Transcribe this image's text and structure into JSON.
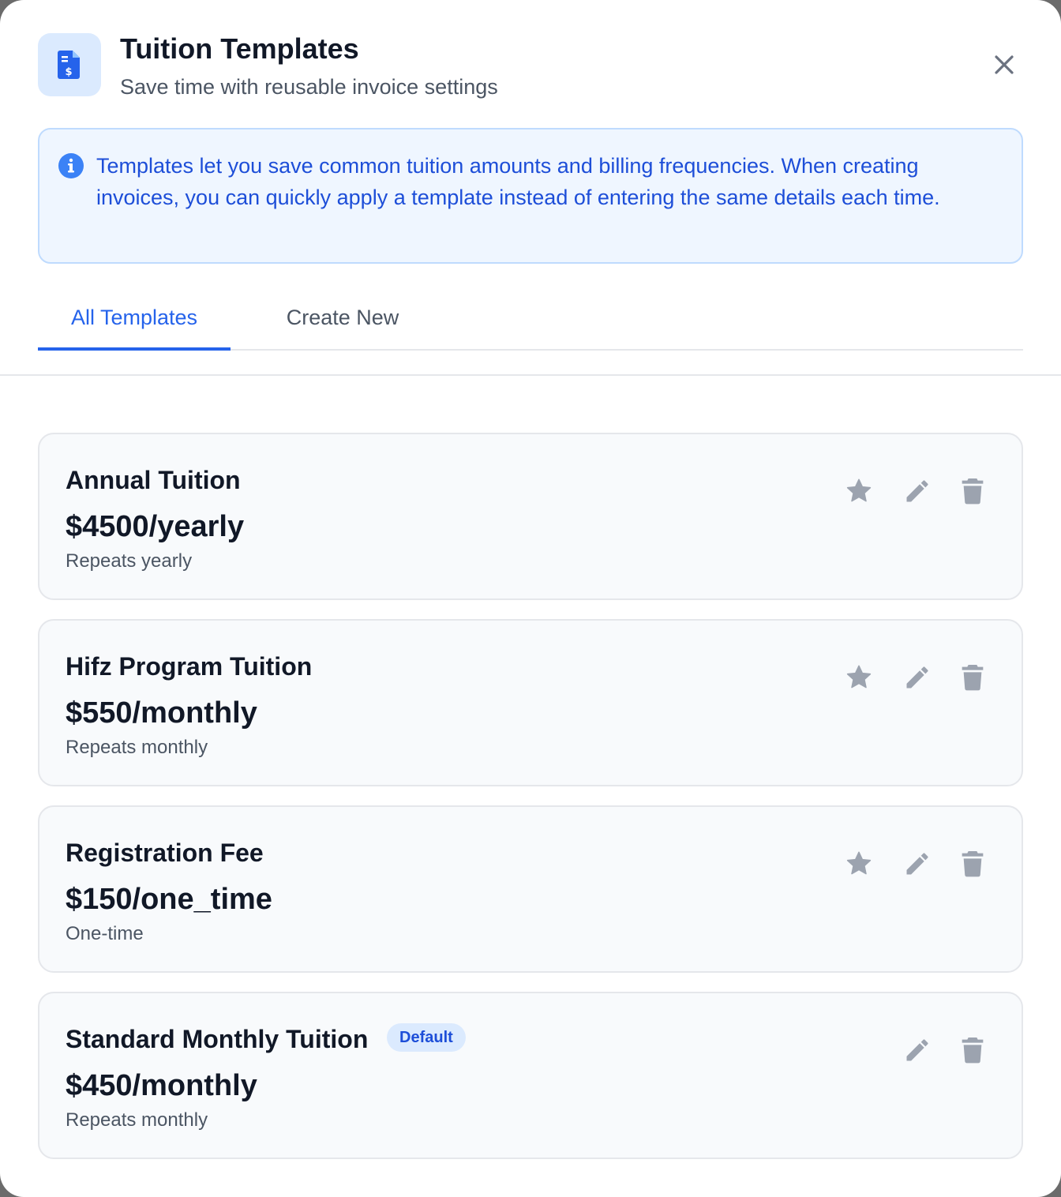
{
  "header": {
    "title": "Tuition Templates",
    "subtitle": "Save time with reusable invoice settings",
    "icon": "invoice-dollar-icon"
  },
  "info": {
    "text": "Templates let you save common tuition amounts and billing frequencies. When creating invoices, you can quickly apply a template instead of entering the same details each time."
  },
  "tabs": [
    {
      "label": "All Templates",
      "active": true
    },
    {
      "label": "Create New",
      "active": false
    }
  ],
  "templates": [
    {
      "name": "Annual Tuition",
      "amount": "$4500/yearly",
      "repeat": "Repeats yearly",
      "default": false
    },
    {
      "name": "Hifz Program Tuition",
      "amount": "$550/monthly",
      "repeat": "Repeats monthly",
      "default": false
    },
    {
      "name": "Registration Fee",
      "amount": "$150/one_time",
      "repeat": "One-time",
      "default": false
    },
    {
      "name": "Standard Monthly Tuition",
      "amount": "$450/monthly",
      "repeat": "Repeats monthly",
      "default": true,
      "badge": "Default"
    }
  ],
  "colors": {
    "accent": "#2563eb",
    "info_bg": "#eff6ff",
    "icon_gray": "#9ca3af"
  }
}
